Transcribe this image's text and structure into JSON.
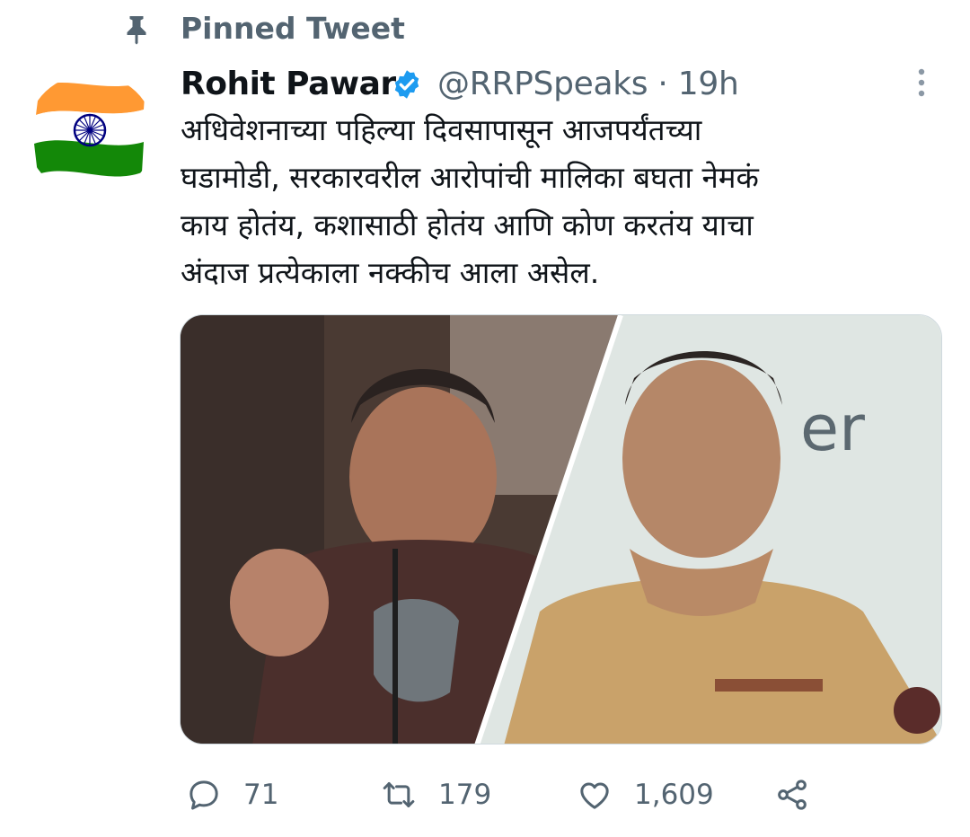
{
  "pinned": {
    "label": "Pinned Tweet",
    "icon": "pin-icon"
  },
  "author": {
    "display_name": "Rohit Pawar",
    "verified_icon": "verified-badge-icon",
    "handle": "@RRPSpeaks",
    "separator": "·",
    "time": "19h"
  },
  "tweet": {
    "lines": [
      "अधिवेशनाच्या पहिल्या दिवसापासून आजपर्यंतच्या",
      "घडामोडी, सरकारवरील आरोपांची मालिका बघता नेमकं",
      "काय  होतंय, कशासाठी होतंय आणि कोण करतंय याचा",
      "अंदाज प्रत्येकाला नक्कीच आला असेल."
    ]
  },
  "actions": {
    "reply_count": "71",
    "retweet_count": "179",
    "like_count": "1,609"
  },
  "colors": {
    "text": "#0f1419",
    "secondary": "#536471",
    "verified": "#1d9bf0",
    "saffron": "#ff9933",
    "india_green": "#138808",
    "chakra": "#000080"
  }
}
